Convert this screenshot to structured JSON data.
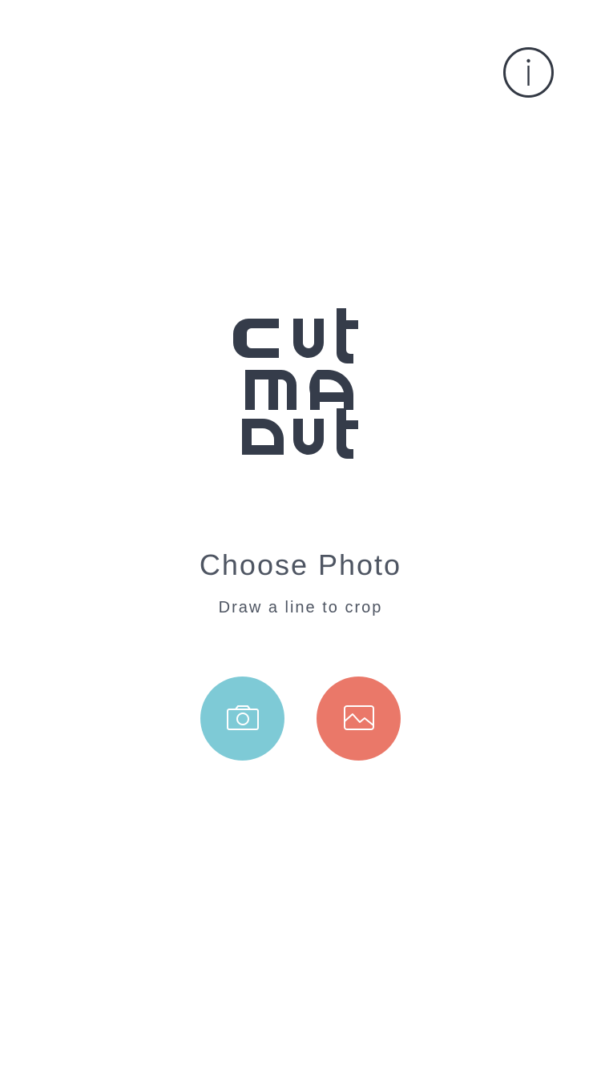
{
  "app": {
    "logo_text": [
      "cut",
      "me",
      "out"
    ],
    "brand_color": "#353c4a"
  },
  "header": {
    "info_icon": "info-circle-icon"
  },
  "main": {
    "title": "Choose Photo",
    "subtitle": "Draw a line to crop"
  },
  "actions": {
    "camera": {
      "icon": "camera-icon",
      "color": "#7ecad6"
    },
    "gallery": {
      "icon": "image-icon",
      "color": "#ea7869"
    }
  }
}
